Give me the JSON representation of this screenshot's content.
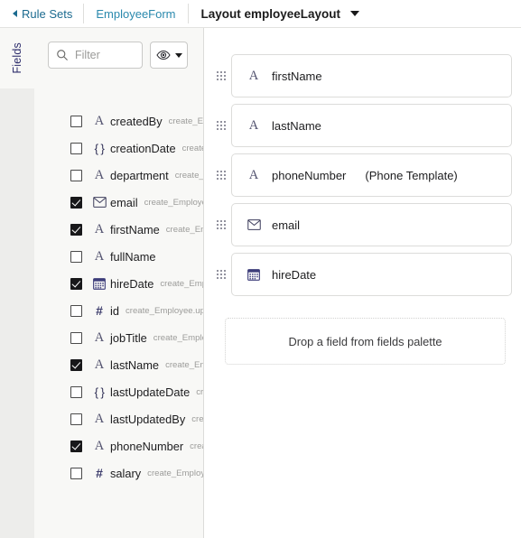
{
  "topbar": {
    "back_label": "Rule Sets",
    "form_link": "EmployeeForm",
    "layout_label": "Layout employeeLayout"
  },
  "fields_panel": {
    "rail_tab_label": "Fields",
    "filter_placeholder": "Filter",
    "filter_value": "",
    "visibility_icon": "eye-icon",
    "fields": [
      {
        "name": "createdBy",
        "meta": "create_Employee.createdBy",
        "icon": "text-icon",
        "checked": false
      },
      {
        "name": "creationDate",
        "meta": "create_Employee.creationDate",
        "icon": "object-icon",
        "checked": false
      },
      {
        "name": "department",
        "meta": "create_Employee.department",
        "icon": "text-icon",
        "checked": false
      },
      {
        "name": "email",
        "meta": "create_Employee.email",
        "icon": "email-icon",
        "checked": true
      },
      {
        "name": "firstName",
        "meta": "create_Employee.firstName",
        "icon": "text-icon",
        "checked": true
      },
      {
        "name": "fullName",
        "meta": "",
        "icon": "text-icon",
        "checked": false
      },
      {
        "name": "hireDate",
        "meta": "create_Employee.hireDate",
        "icon": "calendar-icon",
        "checked": true
      },
      {
        "name": "id",
        "meta": "create_Employee.updatedBy",
        "icon": "number-icon",
        "checked": false
      },
      {
        "name": "jobTitle",
        "meta": "create_Employee.jobTitle",
        "icon": "text-icon",
        "checked": false
      },
      {
        "name": "lastName",
        "meta": "create_Employee.lastName",
        "icon": "text-icon",
        "checked": true
      },
      {
        "name": "lastUpdateDate",
        "meta": "create_Employee.lastUpdateDate",
        "icon": "object-icon",
        "checked": false
      },
      {
        "name": "lastUpdatedBy",
        "meta": "create_Employee.lastUpdatedBy",
        "icon": "text-icon",
        "checked": false
      },
      {
        "name": "phoneNumber",
        "meta": "create_Employee.phoneNumber",
        "icon": "text-icon",
        "checked": true
      },
      {
        "name": "salary",
        "meta": "create_Employee.salary",
        "icon": "number-icon",
        "checked": false
      }
    ]
  },
  "canvas": {
    "cards": [
      {
        "title": "firstName",
        "template": "",
        "icon": "text-icon"
      },
      {
        "title": "lastName",
        "template": "",
        "icon": "text-icon"
      },
      {
        "title": "phoneNumber",
        "template": "(Phone Template)",
        "icon": "text-icon"
      },
      {
        "title": "email",
        "template": "",
        "icon": "email-icon"
      },
      {
        "title": "hireDate",
        "template": "",
        "icon": "calendar-icon"
      }
    ],
    "dropzone_label": "Drop a field from fields palette"
  },
  "colors": {
    "link": "#2a89ad",
    "back_link": "#1b6a8f",
    "rail_bg": "#ededeb",
    "panel_bg": "#f8f8f6",
    "border": "#dcdcda"
  }
}
